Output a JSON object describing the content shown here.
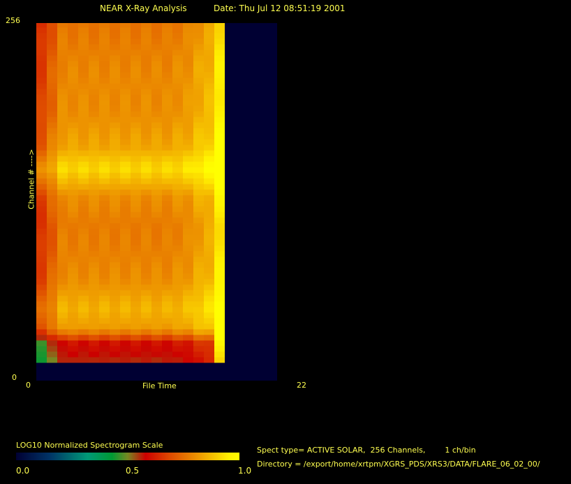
{
  "header": {
    "title": "NEAR X-Ray Analysis",
    "date": "Date: Thu Jul 12 08:51:19 2001"
  },
  "chart_data": {
    "type": "heatmap",
    "xlabel": "File Time",
    "ylabel": "Channel # ---->",
    "xlim": [
      0,
      22
    ],
    "ylim": [
      0,
      256
    ],
    "x_ticks": [
      "0",
      "22"
    ],
    "y_ticks": [
      "0",
      "256"
    ],
    "n_columns": 18,
    "channel_range": [
      13,
      254
    ],
    "channel_profile": {
      "channels": [
        13,
        25,
        35,
        50,
        70,
        90,
        110,
        130,
        150,
        165,
        190,
        220,
        254
      ],
      "values": [
        0.56,
        0.6,
        0.82,
        0.86,
        0.8,
        0.78,
        0.77,
        0.8,
        0.92,
        0.84,
        0.8,
        0.79,
        0.76
      ]
    },
    "column_offsets": [
      -0.12,
      -0.06,
      0,
      0,
      0,
      0,
      0,
      0,
      0,
      0,
      0,
      0,
      0,
      0.01,
      0.02,
      0.05,
      0.07,
      0.16
    ],
    "colorbar": {
      "title": "LOG10 Normalized Spectrogram Scale",
      "ticks": [
        "0.0",
        "0.5",
        "1.0"
      ],
      "range": [
        0,
        1
      ]
    }
  },
  "info": {
    "spect_type": "Spect type= ACTIVE SOLAR,  256 Channels,        1 ch/bin",
    "directory": "Directory = /export/home/xrtpm/XGRS_PDS/XRS3/DATA/FLARE_06_02_00/"
  }
}
